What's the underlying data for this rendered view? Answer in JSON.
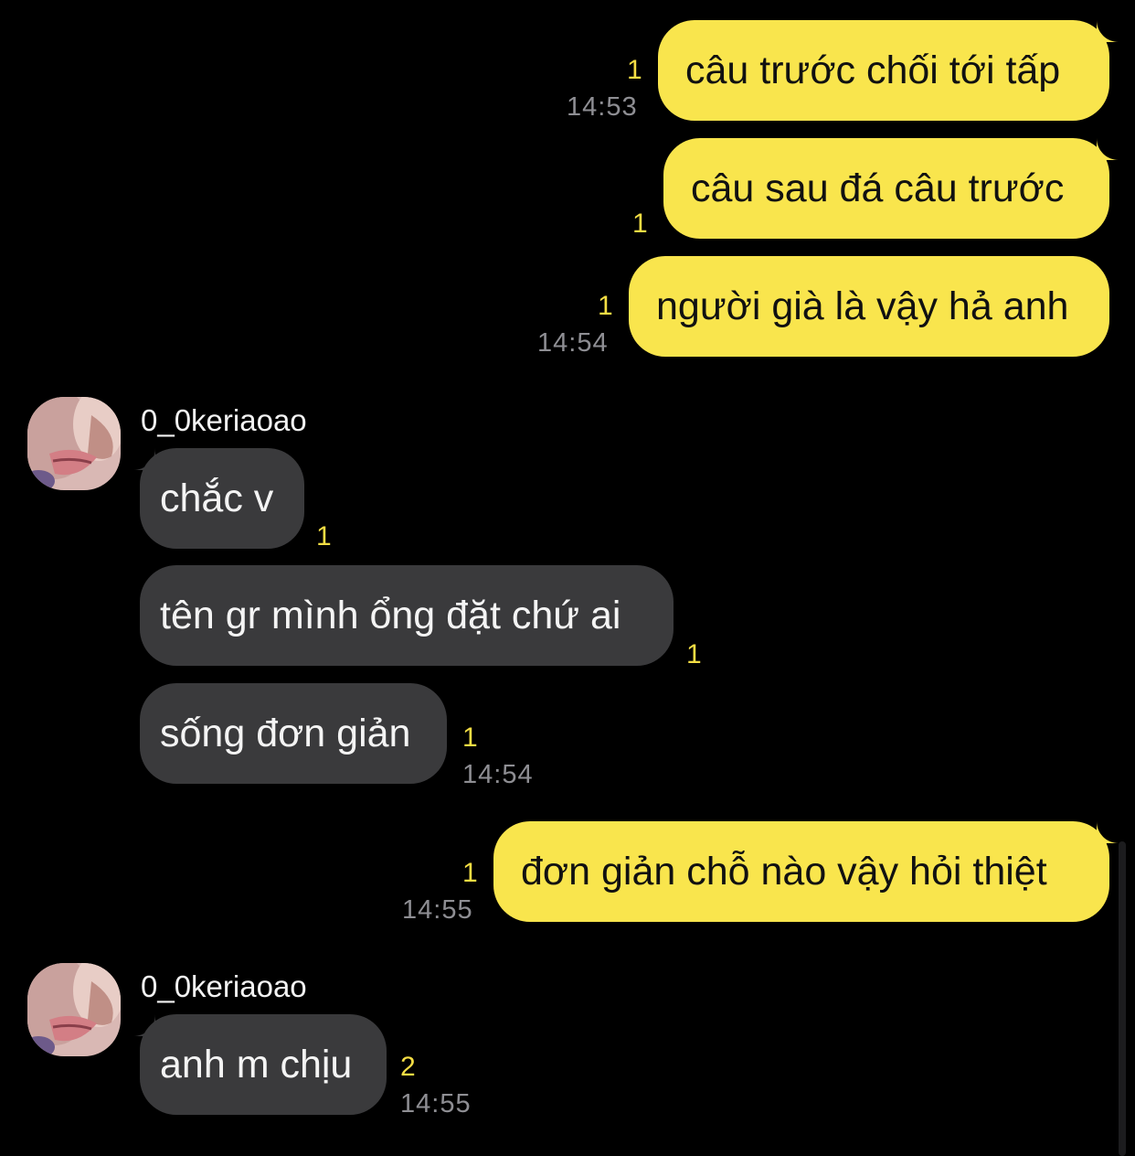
{
  "colors": {
    "background": "#000000",
    "my_bubble": "#f9e54d",
    "their_bubble": "#3a3a3c",
    "unread_count": "#f4dd44",
    "timestamp": "#8e8e93"
  },
  "messages": [
    {
      "side": "mine",
      "text": "câu trước chối tới tấp",
      "unread": "1",
      "time": "14:53"
    },
    {
      "side": "mine",
      "text": "câu sau đá câu trước",
      "unread": "1",
      "time": ""
    },
    {
      "side": "mine",
      "text": "người già là vậy hả anh",
      "unread": "1",
      "time": "14:54"
    },
    {
      "side": "theirs",
      "sender": "0_0keriaoao",
      "text": "chắc v",
      "unread": "1",
      "time": ""
    },
    {
      "side": "theirs",
      "text": "tên gr mình ổng đặt chứ ai",
      "unread": "1",
      "time": ""
    },
    {
      "side": "theirs",
      "text": "sống đơn giản",
      "unread": "1",
      "time": "14:54"
    },
    {
      "side": "mine",
      "text": "đơn giản chỗ nào vậy hỏi thiệt",
      "unread": "1",
      "time": "14:55"
    },
    {
      "side": "theirs",
      "sender": "0_0keriaoao",
      "text": "anh m chịu",
      "unread": "2",
      "time": "14:55"
    }
  ],
  "avatar_icon": "user-avatar-photo"
}
